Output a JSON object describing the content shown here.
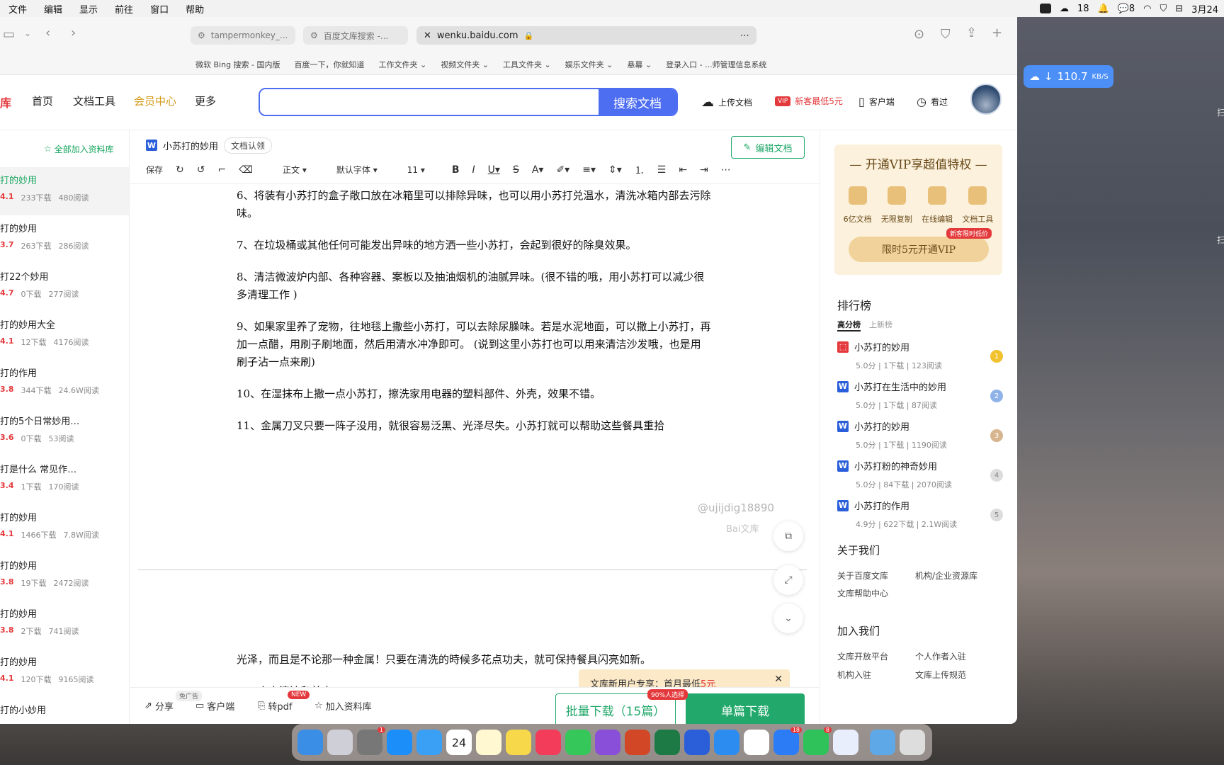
{
  "menubar": {
    "items": [
      "文件",
      "编辑",
      "显示",
      "前往",
      "窗口",
      "帮助"
    ],
    "badge_count": "18",
    "wechat_count": "8",
    "date": "3月24"
  },
  "browser": {
    "tabs": [
      "tampermonkey_...",
      "百度文库搜索 -..."
    ],
    "active_url": "wenku.baidu.com",
    "favorites": [
      "微软 Bing 搜索 - 国内版",
      "百度一下，你就知道",
      "工作文件夹",
      "视频文件夹",
      "工具文件夹",
      "娱乐文件夹",
      "悬幕",
      "登录入口 - ...师管理信息系统"
    ]
  },
  "site": {
    "logo_suffix": "库",
    "nav": [
      "首页",
      "文档工具",
      "会员中心",
      "更多"
    ],
    "search_placeholder": "",
    "search_button": "搜索文档",
    "upload": "上传文档",
    "vip_promo": "新客最低5元",
    "client": "客户端",
    "history": "看过"
  },
  "left_panel": {
    "add_all": "全部加入资料库",
    "items": [
      {
        "title": "打的妙用",
        "score": "4.1",
        "downloads": "233下载",
        "reads": "480阅读"
      },
      {
        "title": "打的妙用",
        "score": "3.7",
        "downloads": "263下载",
        "reads": "286阅读"
      },
      {
        "title": "打22个妙用",
        "score": "4.7",
        "downloads": "0下载",
        "reads": "277阅读"
      },
      {
        "title": "打的妙用大全",
        "score": "4.1",
        "downloads": "12下载",
        "reads": "4176阅读"
      },
      {
        "title": "打的作用",
        "score": "3.8",
        "downloads": "344下载",
        "reads": "24.6W阅读"
      },
      {
        "title": "打的5个日常妙用…",
        "score": "3.6",
        "downloads": "0下载",
        "reads": "53阅读"
      },
      {
        "title": "打是什么 常见作…",
        "score": "3.4",
        "downloads": "1下载",
        "reads": "170阅读"
      },
      {
        "title": "打的妙用",
        "score": "4.1",
        "downloads": "1466下载",
        "reads": "7.8W阅读"
      },
      {
        "title": "打的妙用",
        "score": "3.8",
        "downloads": "19下载",
        "reads": "2472阅读"
      },
      {
        "title": "打的妙用",
        "score": "3.8",
        "downloads": "2下载",
        "reads": "741阅读"
      },
      {
        "title": "打的妙用",
        "score": "4.1",
        "downloads": "120下载",
        "reads": "9165阅读"
      },
      {
        "title": "打的小妙用",
        "score": "",
        "downloads": "",
        "reads": ""
      }
    ]
  },
  "doc": {
    "title": "小苏打的妙用",
    "claim": "文档认领",
    "edit": "编辑文档",
    "toolbar": {
      "save": "保存",
      "style": "正文",
      "font": "默认字体",
      "size": "11"
    },
    "paragraphs": [
      "6、将装有小苏打的盒子敞口放在冰箱里可以排除异味，也可以用小苏打兑温水，清洗冰箱内部去污除味。",
      "7、在垃圾桶或其他任何可能发出异味的地方洒一些小苏打，会起到很好的除臭效果。",
      "8、清洁微波炉内部、各种容器、案板以及抽油烟机的油腻异味。(很不错的哦，用小苏打可以减少很多清理工作 )",
      "9、如果家里养了宠物，往地毯上撒些小苏打，可以去除尿臊味。若是水泥地面，可以撒上小苏打，再加一点醋，用刷子刷地面，然后用清水冲净即可。 (说到这里小苏打也可以用来清洁沙发哦，也是用刷子沾一点来刷)",
      "10、在湿抹布上撒一点小苏打，擦洗家用电器的塑料部件、外壳，效果不错。",
      "11、金属刀叉只要一阵子没用，就很容易泛黑、光泽尽失。小苏打就可以帮助这些餐具重拾"
    ],
    "watermark_user": "@ujijdig18890",
    "watermark_brand": "Bai文库",
    "page2_text": "光泽，而且是不论那一种金属！只要在清洗的時候多花点功夫，就可保持餐具闪亮如新。",
    "page2_cut": "二、个人清洁和美容:",
    "promo_text": "文库新用户专享：首月最低",
    "promo_price": "5元",
    "bottom": {
      "share": "分享",
      "client": "客户端",
      "topdf": "转pdf",
      "addlib": "加入资料库",
      "ad_tag": "免广告",
      "new_tag": "NEW",
      "pct_tag": "90%人选择",
      "batch": "批量下载（15篇）",
      "single": "单篇下载"
    }
  },
  "right_panel": {
    "vip_title": "开通VIP享超值特权",
    "vip_features": [
      "6亿文档",
      "无限复制",
      "在线编辑",
      "文档工具"
    ],
    "vip_tag": "新客限时低价",
    "vip_button": "限时5元开通VIP",
    "rank_title": "排行榜",
    "rank_tabs": [
      "高分榜",
      "上新榜"
    ],
    "rank_items": [
      {
        "title": "小苏打的妙用",
        "meta": "5.0分 | 1下载 | 123阅读",
        "n": "1"
      },
      {
        "title": "小苏打在生活中的妙用",
        "meta": "5.0分 | 1下载 | 87阅读",
        "n": "2"
      },
      {
        "title": "小苏打的妙用",
        "meta": "5.0分 | 1下载 | 1190阅读",
        "n": "3"
      },
      {
        "title": "小苏打粉的神奇妙用",
        "meta": "5.0分 | 84下载 | 2070阅读",
        "n": "4"
      },
      {
        "title": "小苏打的作用",
        "meta": "4.9分 | 622下载 | 2.1W阅读",
        "n": "5"
      }
    ],
    "about_title": "关于我们",
    "about_links": [
      "关于百度文库",
      "机构/企业资源库",
      "文库帮助中心"
    ],
    "join_title": "加入我们",
    "join_links": [
      "文库开放平台",
      "个人作者入驻",
      "机构入驻",
      "文库上传规范"
    ]
  },
  "net_speed": "110.7",
  "net_unit": "KB/S",
  "dock_calendar": "24",
  "colors": {
    "accent": "#4e6ef2",
    "green": "#21a86a",
    "red": "#e4393c",
    "gold": "#d49a1a"
  }
}
